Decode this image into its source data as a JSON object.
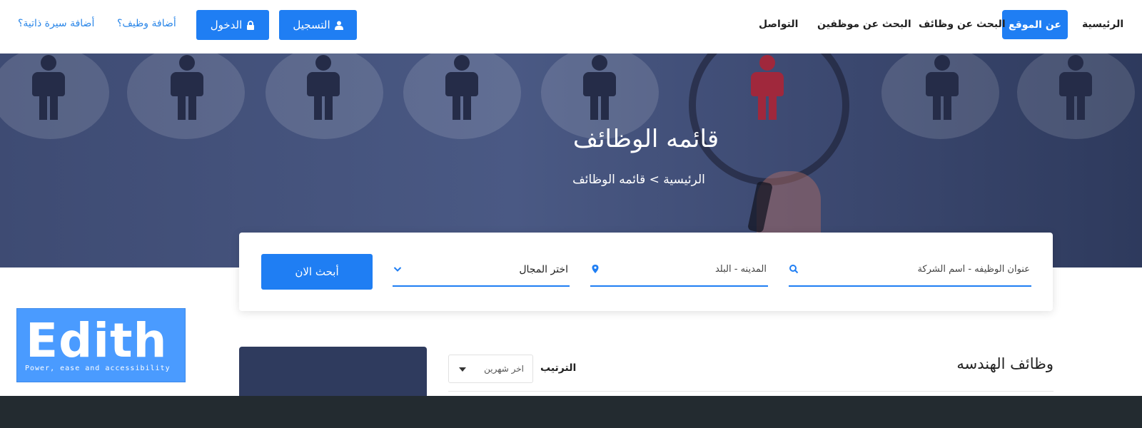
{
  "nav": {
    "home": "الرئيسية",
    "about": "عن الموقع",
    "search_jobs": "البحث عن وظائف",
    "search_employees": "البحث عن موظفين",
    "contact": "التواصل",
    "register": "التسجيل",
    "login": "الدخول",
    "add_job": "أضافة وظيف؟",
    "add_cv": "أضافة سيرة ذاتية؟"
  },
  "hero": {
    "title": "قائمه الوظائف",
    "breadcrumb_home": "الرئيسية",
    "breadcrumb_separator": ">",
    "breadcrumb_current": "قائمه الوظائف"
  },
  "search": {
    "keyword_placeholder": "عنوان الوظيفه - اسم الشركة",
    "location_placeholder": "المدينه - البلد",
    "category_placeholder": "اختر المجال",
    "submit_label": "أبحث الان"
  },
  "listing": {
    "section_title": "وظائف الهندسه",
    "sort_label": "الترتيب",
    "sort_value": "اخر شهرين"
  },
  "brand": {
    "name": "Edith",
    "tagline": "Power, ease and accessibility"
  },
  "colors": {
    "accent": "#1f7ef3",
    "link": "#2a86e8",
    "footer": "#232b30",
    "brand_box": "#4a9bff"
  },
  "icons": {
    "register": "user-icon",
    "login": "lock-icon",
    "keyword": "search-icon",
    "location": "map-pin-icon",
    "category": "chevron-down-icon",
    "sort": "caret-down-icon"
  }
}
